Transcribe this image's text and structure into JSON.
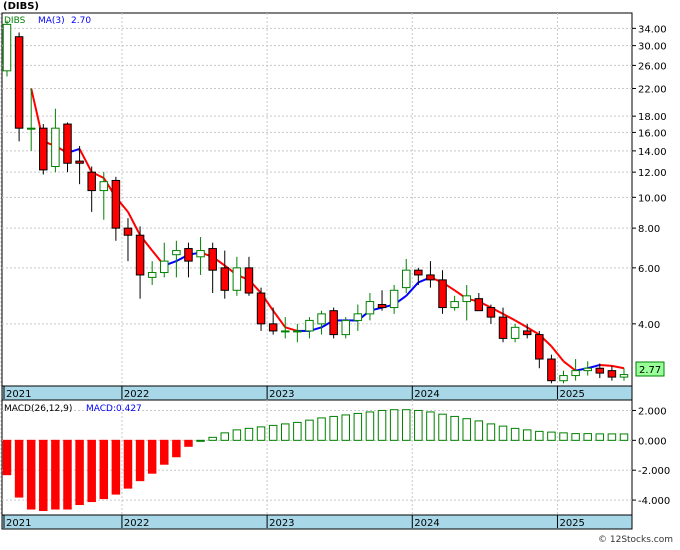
{
  "header": {
    "ticker": "(DIBS)",
    "ma_legend_label": "MA(3)",
    "ma_legend_value": "2.70",
    "last_price": "2.77"
  },
  "macd": {
    "params_label": "MACD(26,12,9)",
    "value_label": "MACD:0.427"
  },
  "watermark": "© 12Stocks.com",
  "years": [
    "2021",
    "2022",
    "2023",
    "2024",
    "2025"
  ],
  "colors": {
    "up": "#008000",
    "down": "#ff0000",
    "ma_down": "#ff0000",
    "ma_up": "#0000ff",
    "macd_pos": "#008000",
    "macd_neg": "#ff0000",
    "axis_band": "#a8d8e8",
    "last_price_box": "#99ff99"
  },
  "chart_data": [
    {
      "type": "candlestick",
      "title": "(DIBS)",
      "scale": "log",
      "interval": "monthly",
      "ylim": [
        2.55,
        38
      ],
      "yticks": [
        "34.00",
        "30.00",
        "26.00",
        "22.00",
        "18.00",
        "16.00",
        "14.00",
        "12.00",
        "10.00",
        "8.00",
        "6.00",
        "4.00"
      ],
      "x_year_labels": [
        "2021",
        "2022",
        "2023",
        "2024",
        "2025"
      ],
      "grid": true,
      "ohlc": [
        {
          "x": 0,
          "o": 25.0,
          "h": 36.0,
          "l": 24.0,
          "c": 35.0
        },
        {
          "x": 1,
          "o": 32.0,
          "h": 33.0,
          "l": 15.0,
          "c": 16.5
        },
        {
          "x": 2,
          "o": 16.5,
          "h": 22.0,
          "l": 14.0,
          "c": 16.5
        },
        {
          "x": 3,
          "o": 16.5,
          "h": 17.0,
          "l": 11.8,
          "c": 12.2
        },
        {
          "x": 4,
          "o": 12.5,
          "h": 19.0,
          "l": 12.0,
          "c": 16.5
        },
        {
          "x": 5,
          "o": 17.0,
          "h": 17.2,
          "l": 12.0,
          "c": 12.8
        },
        {
          "x": 6,
          "o": 13.0,
          "h": 14.5,
          "l": 11.0,
          "c": 12.8
        },
        {
          "x": 7,
          "o": 12.0,
          "h": 12.5,
          "l": 9.0,
          "c": 10.5
        },
        {
          "x": 8,
          "o": 10.5,
          "h": 12.0,
          "l": 8.5,
          "c": 11.2
        },
        {
          "x": 9,
          "o": 11.3,
          "h": 11.6,
          "l": 7.3,
          "c": 8.0
        },
        {
          "x": 10,
          "o": 8.0,
          "h": 8.6,
          "l": 6.3,
          "c": 7.6
        },
        {
          "x": 11,
          "o": 7.6,
          "h": 8.1,
          "l": 4.8,
          "c": 5.7
        },
        {
          "x": 12,
          "o": 5.6,
          "h": 6.3,
          "l": 5.3,
          "c": 5.8
        },
        {
          "x": 13,
          "o": 5.8,
          "h": 7.2,
          "l": 5.6,
          "c": 6.3
        },
        {
          "x": 14,
          "o": 6.6,
          "h": 7.3,
          "l": 5.6,
          "c": 6.8
        },
        {
          "x": 15,
          "o": 6.9,
          "h": 7.2,
          "l": 5.6,
          "c": 6.3
        },
        {
          "x": 16,
          "o": 6.5,
          "h": 7.5,
          "l": 5.7,
          "c": 6.8
        },
        {
          "x": 17,
          "o": 6.9,
          "h": 7.2,
          "l": 5.0,
          "c": 5.9
        },
        {
          "x": 18,
          "o": 6.0,
          "h": 6.8,
          "l": 4.8,
          "c": 5.1
        },
        {
          "x": 19,
          "o": 5.1,
          "h": 6.5,
          "l": 4.9,
          "c": 6.0
        },
        {
          "x": 20,
          "o": 6.0,
          "h": 6.5,
          "l": 4.9,
          "c": 5.0
        },
        {
          "x": 21,
          "o": 5.0,
          "h": 5.2,
          "l": 3.8,
          "c": 4.0
        },
        {
          "x": 22,
          "o": 4.0,
          "h": 4.5,
          "l": 3.7,
          "c": 3.8
        },
        {
          "x": 23,
          "o": 3.8,
          "h": 4.2,
          "l": 3.6,
          "c": 3.8
        },
        {
          "x": 24,
          "o": 3.8,
          "h": 4.0,
          "l": 3.5,
          "c": 3.8
        },
        {
          "x": 25,
          "o": 3.8,
          "h": 4.2,
          "l": 3.6,
          "c": 4.1
        },
        {
          "x": 26,
          "o": 4.0,
          "h": 4.4,
          "l": 3.7,
          "c": 4.3
        },
        {
          "x": 27,
          "o": 4.4,
          "h": 4.5,
          "l": 3.6,
          "c": 3.7
        },
        {
          "x": 28,
          "o": 3.7,
          "h": 4.2,
          "l": 3.6,
          "c": 4.1
        },
        {
          "x": 29,
          "o": 4.1,
          "h": 4.6,
          "l": 3.8,
          "c": 4.3
        },
        {
          "x": 30,
          "o": 4.3,
          "h": 5.0,
          "l": 4.1,
          "c": 4.7
        },
        {
          "x": 31,
          "o": 4.6,
          "h": 5.1,
          "l": 4.4,
          "c": 4.5
        },
        {
          "x": 32,
          "o": 4.5,
          "h": 5.3,
          "l": 4.3,
          "c": 5.1
        },
        {
          "x": 33,
          "o": 5.2,
          "h": 6.4,
          "l": 5.0,
          "c": 5.9
        },
        {
          "x": 34,
          "o": 5.9,
          "h": 6.0,
          "l": 5.3,
          "c": 5.7
        },
        {
          "x": 35,
          "o": 5.7,
          "h": 6.3,
          "l": 5.2,
          "c": 5.5
        },
        {
          "x": 36,
          "o": 5.5,
          "h": 5.9,
          "l": 4.3,
          "c": 4.5
        },
        {
          "x": 37,
          "o": 4.5,
          "h": 4.9,
          "l": 4.4,
          "c": 4.7
        },
        {
          "x": 38,
          "o": 4.7,
          "h": 5.3,
          "l": 4.1,
          "c": 4.9
        },
        {
          "x": 39,
          "o": 4.8,
          "h": 5.0,
          "l": 4.4,
          "c": 4.4
        },
        {
          "x": 40,
          "o": 4.5,
          "h": 4.6,
          "l": 4.0,
          "c": 4.2
        },
        {
          "x": 41,
          "o": 4.2,
          "h": 4.5,
          "l": 3.5,
          "c": 3.6
        },
        {
          "x": 42,
          "o": 3.6,
          "h": 4.0,
          "l": 3.5,
          "c": 3.9
        },
        {
          "x": 43,
          "o": 3.8,
          "h": 4.0,
          "l": 3.6,
          "c": 3.7
        },
        {
          "x": 44,
          "o": 3.7,
          "h": 3.8,
          "l": 2.9,
          "c": 3.1
        },
        {
          "x": 45,
          "o": 3.1,
          "h": 3.2,
          "l": 2.6,
          "c": 2.65
        },
        {
          "x": 46,
          "o": 2.65,
          "h": 2.85,
          "l": 2.6,
          "c": 2.75
        },
        {
          "x": 47,
          "o": 2.75,
          "h": 3.1,
          "l": 2.65,
          "c": 2.85
        },
        {
          "x": 48,
          "o": 2.85,
          "h": 3.05,
          "l": 2.75,
          "c": 2.9
        },
        {
          "x": 49,
          "o": 2.9,
          "h": 3.0,
          "l": 2.7,
          "c": 2.8
        },
        {
          "x": 50,
          "o": 2.85,
          "h": 2.95,
          "l": 2.65,
          "c": 2.72
        },
        {
          "x": 51,
          "o": 2.72,
          "h": 2.9,
          "l": 2.65,
          "c": 2.77
        }
      ],
      "ma_label": "MA(3)",
      "ma3": [
        null,
        null,
        22.0,
        15.0,
        14.5,
        13.8,
        14.2,
        12.0,
        11.5,
        10.0,
        9.0,
        7.6,
        6.8,
        6.1,
        6.3,
        6.6,
        6.7,
        6.5,
        6.1,
        5.7,
        5.5,
        5.0,
        4.4,
        3.9,
        3.8,
        3.8,
        3.9,
        4.1,
        4.1,
        4.1,
        4.4,
        4.5,
        4.6,
        4.9,
        5.4,
        5.6,
        5.4,
        5.1,
        4.8,
        4.7,
        4.5,
        4.3,
        4.1,
        3.9,
        3.7,
        3.4,
        3.05,
        2.85,
        2.9,
        2.97,
        2.95,
        2.9
      ]
    },
    {
      "type": "bar",
      "title": "MACD(26,12,9)",
      "value_label": "MACD:0.427",
      "ylim": [
        -5.0,
        2.7
      ],
      "yticks": [
        "2.000",
        "0.000",
        "-2.000",
        "-4.000"
      ],
      "x_year_labels": [
        "2021",
        "2022",
        "2023",
        "2024",
        "2025"
      ],
      "values": [
        -2.3,
        -3.8,
        -4.6,
        -4.7,
        -4.6,
        -4.6,
        -4.3,
        -4.1,
        -3.9,
        -3.6,
        -3.2,
        -2.7,
        -2.2,
        -1.6,
        -1.1,
        -0.4,
        0.0,
        0.2,
        0.5,
        0.7,
        0.8,
        0.9,
        1.0,
        1.1,
        1.2,
        1.35,
        1.5,
        1.6,
        1.7,
        1.8,
        1.9,
        2.0,
        2.05,
        2.05,
        2.0,
        1.9,
        1.75,
        1.6,
        1.45,
        1.3,
        1.1,
        0.95,
        0.8,
        0.7,
        0.6,
        0.55,
        0.5,
        0.45,
        0.45,
        0.43,
        0.43,
        0.427
      ]
    }
  ]
}
